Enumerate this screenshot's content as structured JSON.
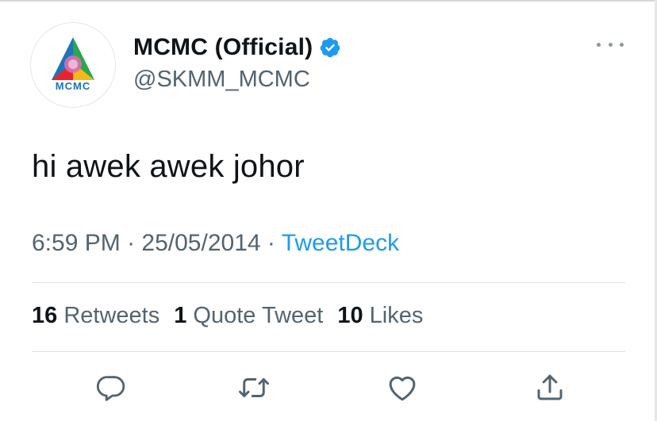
{
  "account": {
    "display_name": "MCMC (Official)",
    "handle": "@SKMM_MCMC",
    "avatar_logo_text": "MCMC",
    "verified": true
  },
  "tweet": {
    "text": "hi awek awek johor",
    "time": "6:59 PM",
    "separator": "·",
    "date": "25/05/2014",
    "source": "TweetDeck"
  },
  "stats": {
    "retweets_count": "16",
    "retweets_label": "Retweets",
    "quotes_count": "1",
    "quotes_label": "Quote Tweet",
    "likes_count": "10",
    "likes_label": "Likes"
  },
  "actions": {
    "reply_icon": "reply-icon",
    "retweet_icon": "retweet-icon",
    "like_icon": "heart-icon",
    "share_icon": "share-icon"
  },
  "colors": {
    "verified_blue": "#1d9bf0",
    "link_blue": "#1d9bf0",
    "secondary_text": "#536471",
    "primary_text": "#0f1419"
  }
}
